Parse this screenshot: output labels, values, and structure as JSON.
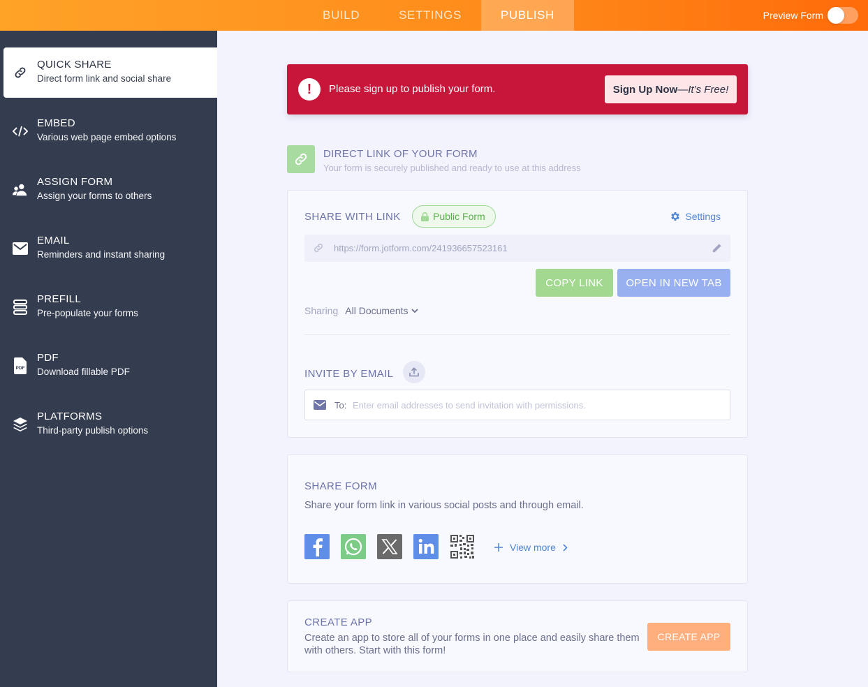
{
  "topbar": {
    "tabs": [
      {
        "label": "BUILD"
      },
      {
        "label": "SETTINGS"
      },
      {
        "label": "PUBLISH"
      }
    ],
    "active_tab": "PUBLISH",
    "preview_label": "Preview Form",
    "preview_enabled": false
  },
  "sidebar": {
    "items": [
      {
        "title": "QUICK SHARE",
        "desc": "Direct form link and social share",
        "icon": "link-icon"
      },
      {
        "title": "EMBED",
        "desc": "Various web page embed options",
        "icon": "code-icon"
      },
      {
        "title": "ASSIGN FORM",
        "desc": "Assign your forms to others",
        "icon": "users-icon"
      },
      {
        "title": "EMAIL",
        "desc": "Reminders and instant sharing",
        "icon": "envelope-icon"
      },
      {
        "title": "PREFILL",
        "desc": "Pre-populate your forms",
        "icon": "database-icon"
      },
      {
        "title": "PDF",
        "desc": "Download fillable PDF",
        "icon": "pdf-icon"
      },
      {
        "title": "PLATFORMS",
        "desc": "Third-party publish options",
        "icon": "layers-icon"
      }
    ],
    "active_index": 0
  },
  "alert": {
    "text": "Please sign up to publish your form.",
    "button_strong": "Sign Up Now",
    "button_em": "—It’s Free!"
  },
  "direct_link": {
    "title": "DIRECT LINK OF YOUR FORM",
    "subtitle": "Your form is securely published and ready to use at this address"
  },
  "share_link": {
    "label": "SHARE WITH LINK",
    "badge": "Public Form",
    "settings_label": "Settings",
    "url": "https://form.jotform.com/241936657523161",
    "copy_label": "COPY LINK",
    "open_label": "OPEN IN NEW TAB",
    "sharing_label": "Sharing",
    "sharing_value": "All Documents"
  },
  "invite": {
    "label": "INVITE BY EMAIL",
    "to_label": "To:",
    "placeholder": "Enter email addresses to send invitation with permissions."
  },
  "share_form": {
    "title": "SHARE FORM",
    "desc": "Share your form link in various social posts and through email.",
    "socials": [
      "facebook-icon",
      "whatsapp-icon",
      "x-icon",
      "linkedin-icon",
      "qr-code-icon"
    ],
    "view_more": "View more"
  },
  "create_app": {
    "title": "CREATE APP",
    "desc": "Create an app to store all of your forms in one place and easily share them with others. Start with this form!",
    "button": "CREATE APP"
  },
  "colors": {
    "accent_orange": "#ff8a1a",
    "sidebar_bg": "#343c4f",
    "alert_red": "#c8153a",
    "green": "#a3d890",
    "blue": "#98b0f0"
  }
}
